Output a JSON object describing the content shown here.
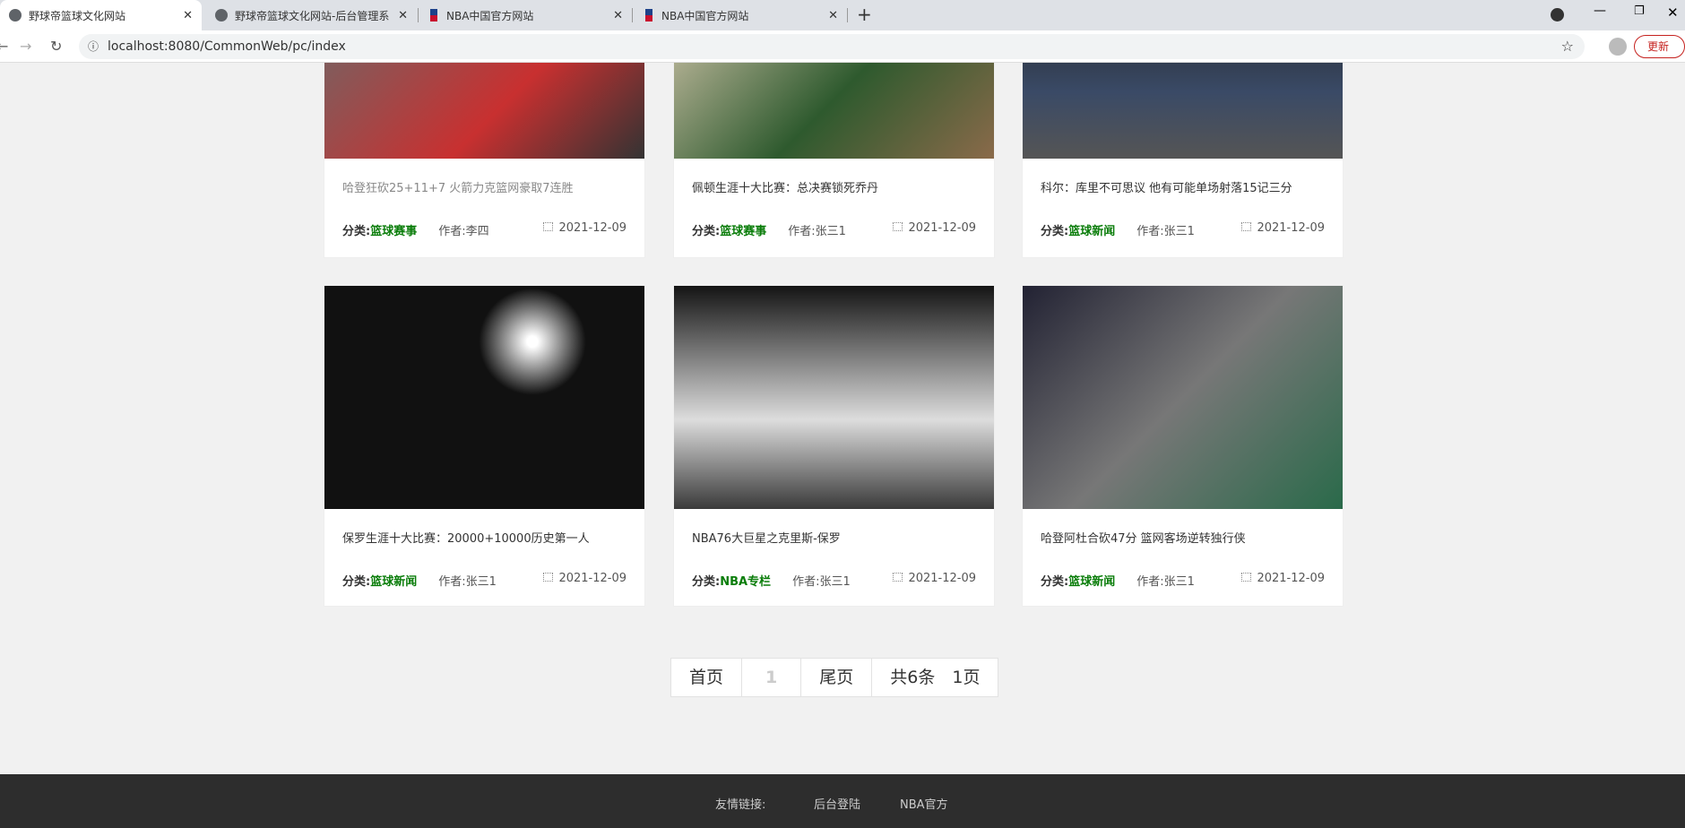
{
  "browser": {
    "tabs": [
      {
        "label": "野球帝篮球文化网站"
      },
      {
        "label": "野球帝篮球文化网站-后台管理系"
      },
      {
        "label": "NBA中国官方网站"
      },
      {
        "label": "NBA中国官方网站"
      }
    ],
    "url": "localhost:8080/CommonWeb/pc/index",
    "update_label": "更新"
  },
  "cards": [
    {
      "title": "哈登狂砍25+11+7 火箭力克篮网豪取7连胜",
      "category_label": "分类:",
      "category": "篮球赛事",
      "author": "作者:李四",
      "date": "2021-12-09"
    },
    {
      "title": "佩顿生涯十大比赛：总决赛锁死乔丹",
      "category_label": "分类:",
      "category": "篮球赛事",
      "author": "作者:张三1",
      "date": "2021-12-09"
    },
    {
      "title": "科尔：库里不可思议 他有可能单场射落15记三分",
      "category_label": "分类:",
      "category": "篮球新闻",
      "author": "作者:张三1",
      "date": "2021-12-09"
    },
    {
      "title": "保罗生涯十大比赛：20000+10000历史第一人",
      "category_label": "分类:",
      "category": "篮球新闻",
      "author": "作者:张三1",
      "date": "2021-12-09"
    },
    {
      "title": "NBA76大巨星之克里斯-保罗",
      "category_label": "分类:",
      "category": "NBA专栏",
      "author": "作者:张三1",
      "date": "2021-12-09"
    },
    {
      "title": "哈登阿杜合砍47分 篮网客场逆转独行侠",
      "category_label": "分类:",
      "category": "篮球新闻",
      "author": "作者:张三1",
      "date": "2021-12-09"
    }
  ],
  "pagination": {
    "first": "首页",
    "current": "1",
    "last": "尾页",
    "total": "共6条　1页"
  },
  "footer": {
    "label": "友情链接:",
    "links": [
      "后台登陆",
      "NBA官方"
    ]
  }
}
